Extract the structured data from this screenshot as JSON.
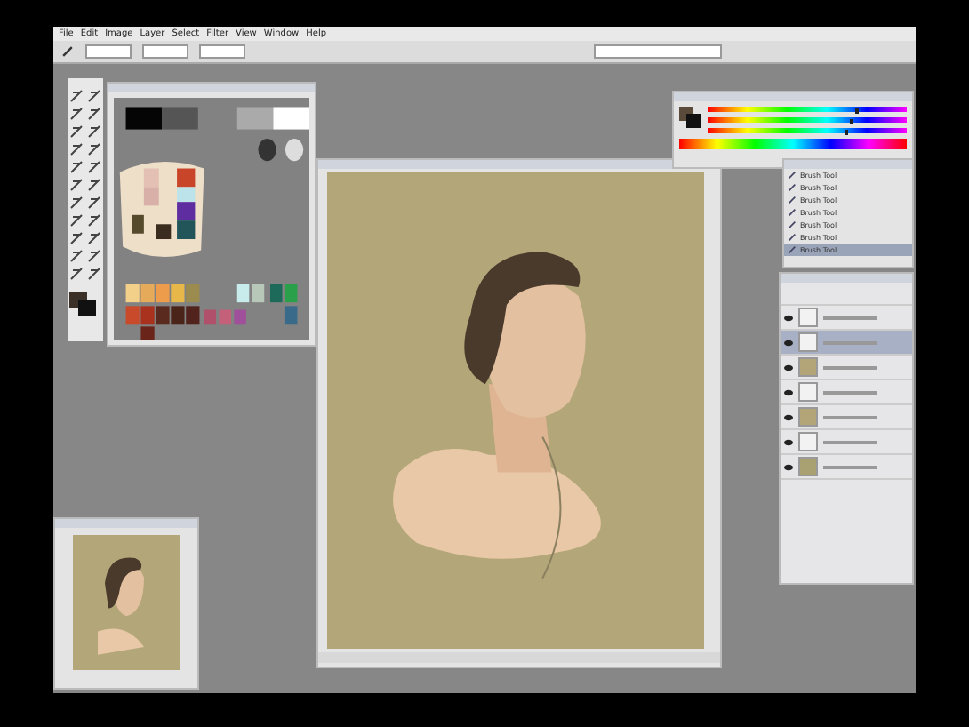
{
  "menu": [
    "File",
    "Edit",
    "Image",
    "Layer",
    "Select",
    "Filter",
    "View",
    "Window",
    "Help"
  ],
  "color_sliders": [
    {
      "level": 0.75
    },
    {
      "level": 0.72
    },
    {
      "level": 0.7
    }
  ],
  "history": [
    {
      "label": "Brush Tool",
      "selected": false
    },
    {
      "label": "Brush Tool",
      "selected": false
    },
    {
      "label": "Brush Tool",
      "selected": false
    },
    {
      "label": "Brush Tool",
      "selected": false
    },
    {
      "label": "Brush Tool",
      "selected": false
    },
    {
      "label": "Brush Tool",
      "selected": false
    },
    {
      "label": "Brush Tool",
      "selected": true
    }
  ],
  "layers": [
    {
      "kind": "blank",
      "selected": false,
      "visible": true
    },
    {
      "kind": "blank",
      "selected": true,
      "visible": true
    },
    {
      "kind": "painting",
      "selected": false,
      "visible": true
    },
    {
      "kind": "blank",
      "selected": false,
      "visible": true
    },
    {
      "kind": "painting",
      "selected": false,
      "visible": true
    },
    {
      "kind": "blank",
      "selected": false,
      "visible": true
    },
    {
      "kind": "fill",
      "selected": false,
      "visible": true
    }
  ]
}
